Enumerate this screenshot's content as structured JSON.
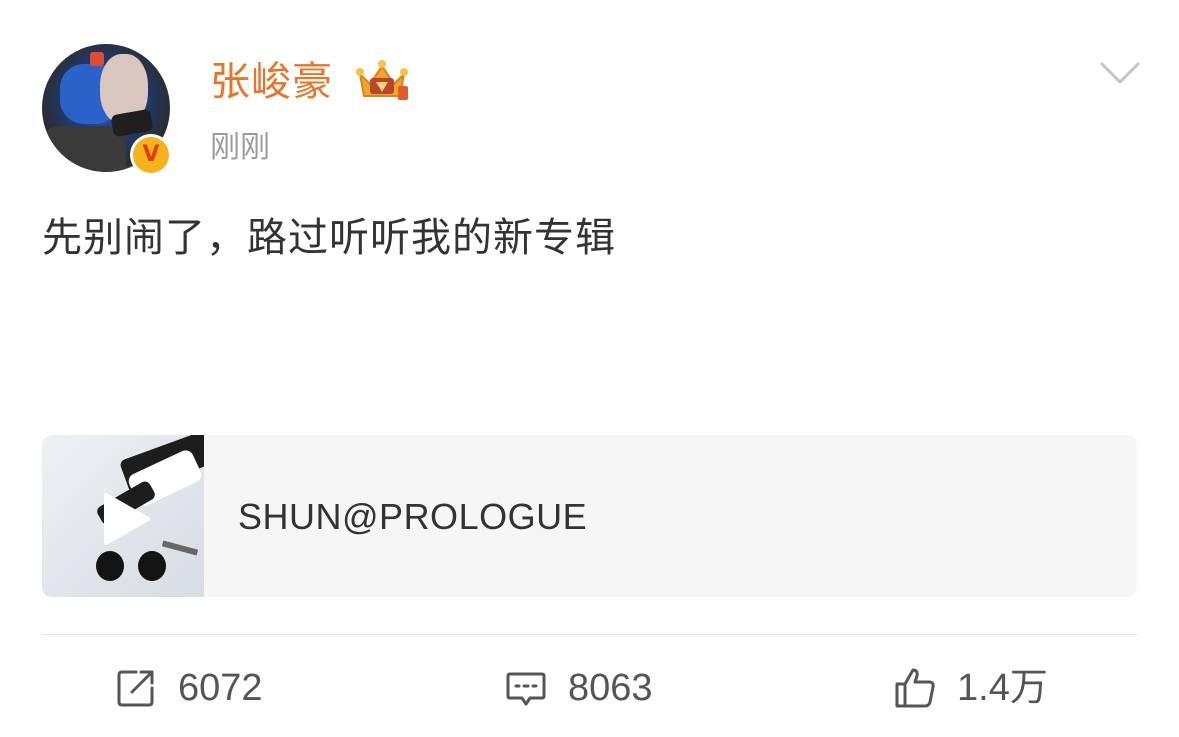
{
  "post": {
    "author": {
      "name": "张峻豪",
      "avatar_icon": "user-avatar",
      "verified_badge_icon": "verified-v-badge-icon",
      "vip_badge_icon": "crown-icon"
    },
    "timestamp": "刚刚",
    "menu_icon": "chevron-down-icon",
    "text": "先别闹了，路过听听我的新专辑",
    "music_card": {
      "title": "SHUN@PROLOGUE",
      "cover_icon": "album-cover",
      "play_icon": "play-icon"
    },
    "actions": {
      "repost_count": "6072",
      "comment_count": "8063",
      "like_count": "1.4万"
    }
  },
  "colors": {
    "username": "#eb7424",
    "timestamp": "#9b9b9b",
    "text": "#333333",
    "card_bg": "#f6f6f6",
    "badge": "#f6b21a"
  }
}
